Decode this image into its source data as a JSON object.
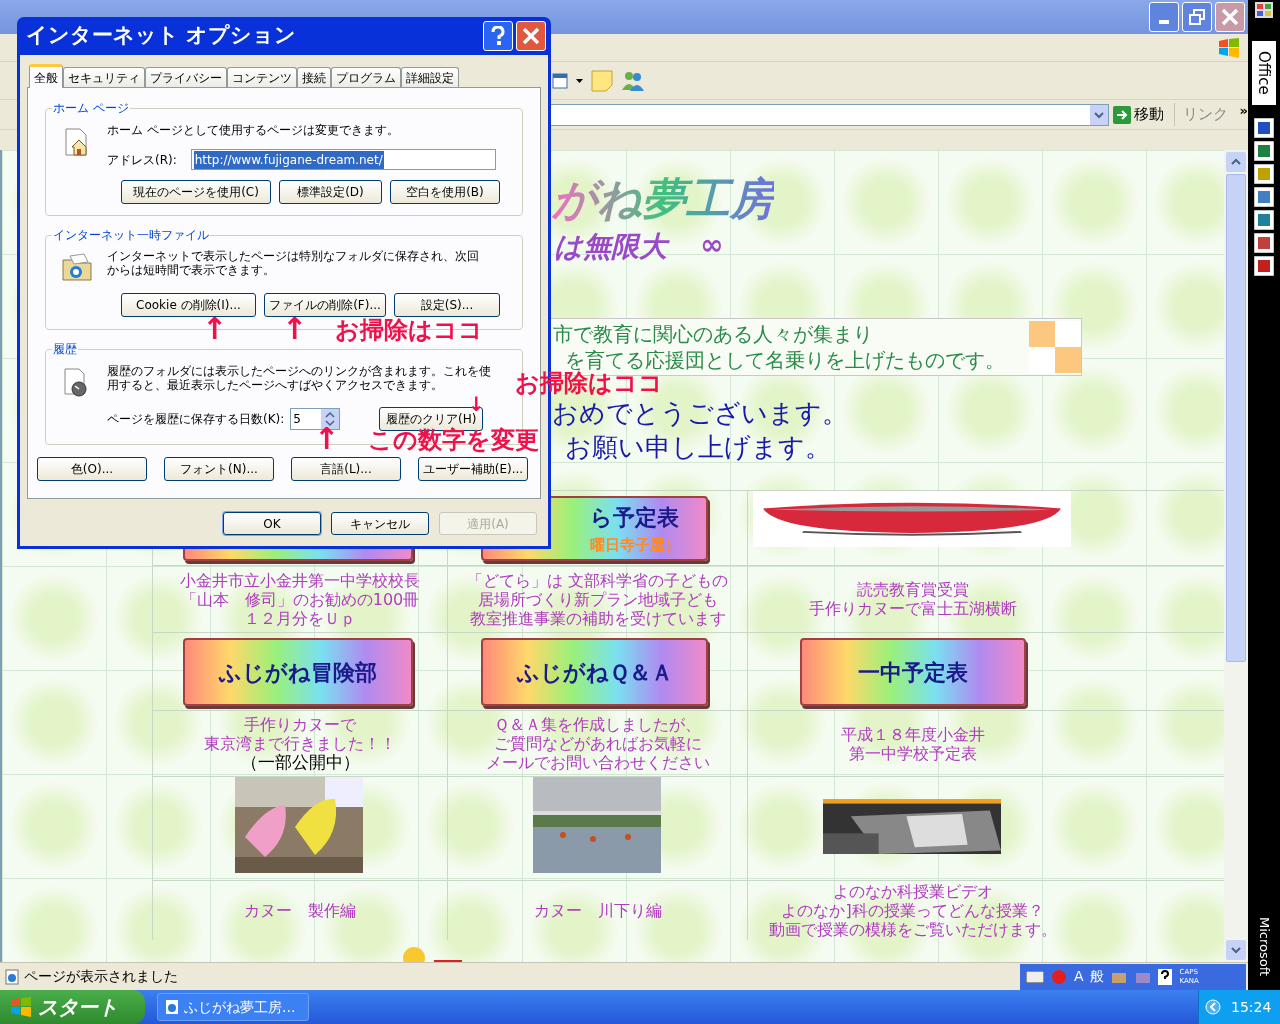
{
  "browser": {
    "go_button": "移動",
    "links_label": "リンク",
    "more": "»"
  },
  "page": {
    "logo": "がね夢工房",
    "tagline": "は無限大",
    "infinity": "∞",
    "intro_lines": [
      "市で教育に関心のある人々が集まり",
      "を育てる応援団として名乗りを上げたものです。"
    ],
    "greeting_lines": [
      "おめでとうございます。",
      "お願い申し上げます。"
    ],
    "grid": [
      {
        "cells": [
          {
            "kind": "button"
          },
          {
            "kind": "button",
            "label": "ら予定表",
            "sublabel": "曜日寺子屋）"
          },
          {
            "kind": "picture"
          }
        ]
      },
      {
        "cells": [
          {
            "kind": "caption",
            "lines": [
              "小金井市立小金井第一中学校校長",
              "「山本　修司」のお勧めの100冊",
              "１２月分をＵｐ"
            ]
          },
          {
            "kind": "caption",
            "lines": [
              "「どてら」は 文部科学省の子どもの",
              "居場所づくり新プラン地域子ども",
              "教室推進事業の補助を受けています"
            ]
          },
          {
            "kind": "caption",
            "lines": [
              "読売教育賞受賞",
              "手作りカヌーで富士五湖横断"
            ]
          }
        ]
      },
      {
        "cells": [
          {
            "kind": "button",
            "label": "ふじがね冒険部"
          },
          {
            "kind": "button",
            "label": "ふじがねＱ＆Ａ"
          },
          {
            "kind": "button",
            "label": "一中予定表"
          }
        ]
      },
      {
        "cells": [
          {
            "kind": "caption",
            "lines": [
              "手作りカヌーで",
              "東京湾まで行きました！！"
            ],
            "note": "（一部公開中）"
          },
          {
            "kind": "caption",
            "lines": [
              "Ｑ＆Ａ集を作成しましたが、",
              "ご質問などがあればお気軽に",
              "メールでお問い合わせください"
            ]
          },
          {
            "kind": "caption",
            "lines": [
              "平成１８年度小金井",
              "第一中学校予定表"
            ]
          }
        ]
      },
      {
        "cells": [
          {
            "kind": "picture"
          },
          {
            "kind": "picture"
          },
          {
            "kind": "picture"
          }
        ]
      },
      {
        "cells": [
          {
            "kind": "caption",
            "lines": [
              "カヌー　製作編"
            ]
          },
          {
            "kind": "caption",
            "lines": [
              "カヌー　川下り編"
            ]
          },
          {
            "kind": "caption",
            "lines": [
              "よのなか科授業ビデオ",
              "よのなか]科の授業ってどんな授業？",
              "動画で授業の模様をご覧いただけます。"
            ]
          }
        ]
      }
    ]
  },
  "status_bar": {
    "text": "ページが表示されました",
    "ime_mode": "A",
    "ime_kanji": "般",
    "caps": "CAPS",
    "kana": "KANA"
  },
  "taskbar": {
    "start": "スタート",
    "tasks": [
      {
        "label": "ふじがね夢工房...",
        "selected": false
      }
    ],
    "clock": "15:24"
  },
  "office_bar": {
    "title": "Office",
    "footer": "Microsoft"
  },
  "dialog": {
    "title": "インターネット オプション",
    "tabs": [
      {
        "label": "全般",
        "selected": true
      },
      {
        "label": "セキュリティ",
        "selected": false
      },
      {
        "label": "プライバシー",
        "selected": false
      },
      {
        "label": "コンテンツ",
        "selected": false
      },
      {
        "label": "接続",
        "selected": false
      },
      {
        "label": "プログラム",
        "selected": false
      },
      {
        "label": "詳細設定",
        "selected": false
      }
    ],
    "home_page": {
      "legend": "ホーム ページ",
      "description": [
        "ホーム ページとして使用するページは変更できます。"
      ],
      "address_label": "アドレス(R):",
      "address": "http://www.fujigane-dream.net/",
      "address_selected": true,
      "buttons": [
        "現在のページを使用(C)",
        "標準設定(D)",
        "空白を使用(B)"
      ]
    },
    "temp_files": {
      "legend": "インターネット一時ファイル",
      "description": [
        "インターネットで表示したページは特別なフォルダに保存され、次回",
        "からは短時間で表示できます。"
      ],
      "buttons": [
        "Cookie の削除(I)...",
        "ファイルの削除(F)...",
        "設定(S)..."
      ]
    },
    "history": {
      "legend": "履歴",
      "description": [
        "履歴のフォルダには表示したページへのリンクが含まれます。これを使",
        "用すると、最近表示したページへすばやくアクセスできます。"
      ],
      "days_label": "ページを履歴に保存する日数(K):",
      "days": "5",
      "clear_button": "履歴のクリア(H)"
    },
    "bottom_buttons": [
      "色(O)...",
      "フォント(N)...",
      "言語(L)...",
      "ユーザー補助(E)..."
    ],
    "footer_buttons": [
      {
        "label": "OK",
        "disabled": false
      },
      {
        "label": "キャンセル",
        "disabled": false
      },
      {
        "label": "適用(A)",
        "disabled": true
      }
    ]
  },
  "annotations": [
    {
      "text": "↑"
    },
    {
      "text": "↑"
    },
    {
      "text": "お掃除はココ"
    },
    {
      "text": "↓"
    },
    {
      "text": "お掃除はココ"
    },
    {
      "text": "↑"
    },
    {
      "text": "この数字を変更"
    }
  ]
}
